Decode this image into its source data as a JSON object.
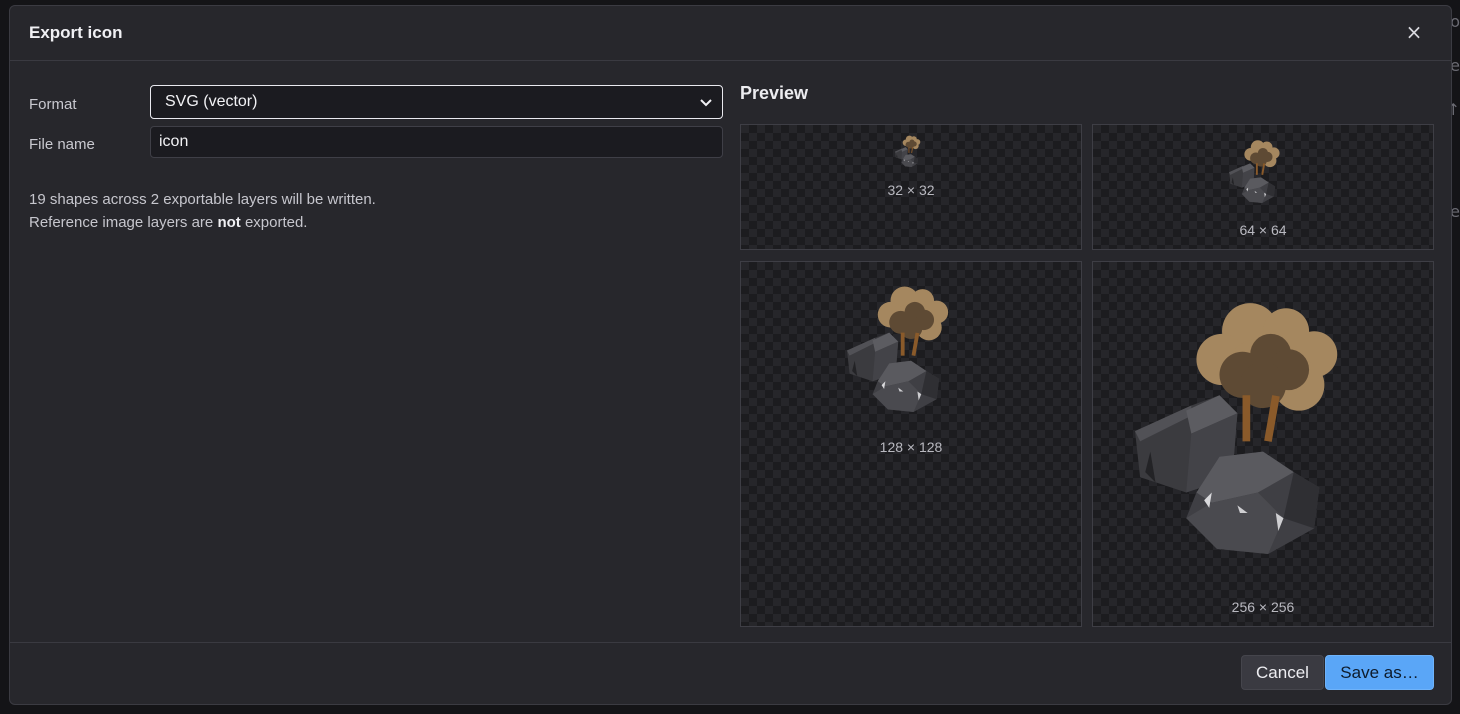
{
  "dialog": {
    "title": "Export icon",
    "close_glyph": "×"
  },
  "form": {
    "format_label": "Format",
    "format_value": "SVG (vector)",
    "filename_label": "File name",
    "filename_value": "icon"
  },
  "info": {
    "line1": "19 shapes across 2 exportable layers will be written.",
    "line2_prefix": "Reference image layers are",
    "line2_bold": "not",
    "line2_suffix": "exported."
  },
  "preview": {
    "title": "Preview",
    "tiles": [
      {
        "label": "32 × 32"
      },
      {
        "label": "64 × 64"
      },
      {
        "label": "128 × 128"
      },
      {
        "label": "256 × 256"
      }
    ]
  },
  "footer": {
    "cancel_label": "Cancel",
    "save_label": "Save as…"
  },
  "icons": {
    "close": "close-icon",
    "dropdown": "chevron-down-icon"
  },
  "colors": {
    "dialog_bg": "#27272c",
    "accent": "#5aa6f7",
    "rock": "#4a4a4f",
    "tree_light": "#a5875f",
    "tree_dark": "#5e4a34",
    "trunk": "#8a5a2a"
  }
}
